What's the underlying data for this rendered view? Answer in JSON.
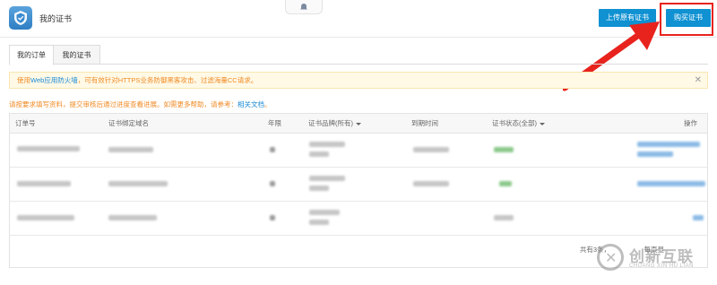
{
  "header": {
    "title": "我的证书",
    "upload_label": "上传原有证书",
    "buy_label": "购买证书"
  },
  "tabs": [
    {
      "label": "我的订单",
      "active": true
    },
    {
      "label": "我的证书",
      "active": false
    }
  ],
  "alert": {
    "prefix": "使用",
    "link": "Web应用防火墙",
    "suffix": "，可有效针对HTTPS业务防御黑客攻击、过滤海量CC请求。",
    "close": "✕"
  },
  "tip": {
    "text": "请按要求填写资料，提交审核后通过进度查看进展。如需更多帮助，请参考：",
    "link": "相关文档",
    "end": "。"
  },
  "table": {
    "columns": [
      "订单号",
      "证书绑定域名",
      "年限",
      "证书品牌(所有)",
      "到期时间",
      "证书状态(全部)",
      "操作"
    ]
  },
  "footer": {
    "total": "共有3条，",
    "per_page": "每页显"
  },
  "watermark": {
    "title": "创新互联",
    "sub": "CHUANG XIN HU LIAN"
  },
  "colors": {
    "primary": "#0f91d2",
    "highlight": "#e8231e",
    "warning": "#f08a24",
    "link": "#1a8ad4"
  }
}
